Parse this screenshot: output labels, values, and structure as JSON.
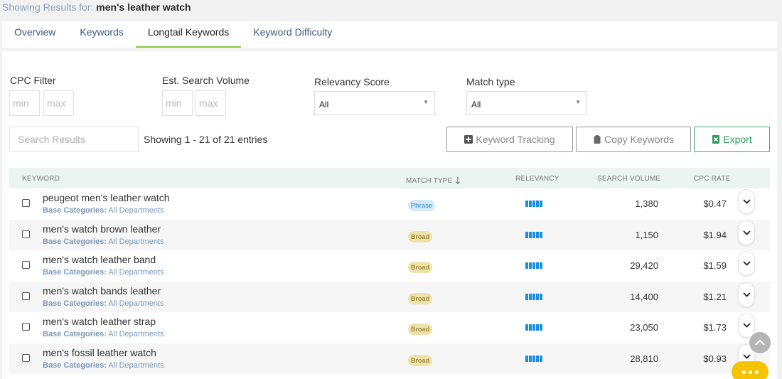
{
  "header": {
    "prefix": "Showing Results for:",
    "query": "men's leather watch"
  },
  "tabs": [
    {
      "label": "Overview"
    },
    {
      "label": "Keywords"
    },
    {
      "label": "Longtail Keywords",
      "active": true
    },
    {
      "label": "Keyword Difficulty"
    }
  ],
  "filters": {
    "cpc_label": "CPC Filter",
    "volume_label": "Est. Search Volume",
    "relevancy_label": "Relevancy Score",
    "match_label": "Match type",
    "min_placeholder": "min",
    "max_placeholder": "max",
    "relevancy_value": "All",
    "match_value": "All"
  },
  "search": {
    "placeholder": "Search Results"
  },
  "entries_text": "Showing 1 - 21 of 21 entries",
  "buttons": {
    "tracking": "Keyword Tracking",
    "copy": "Copy Keywords",
    "export": "Export"
  },
  "columns": {
    "keyword": "KEYWORD",
    "match": "MATCH TYPE",
    "relevancy": "RELEVANCY",
    "volume": "SEARCH VOLUME",
    "cpc": "CPC RATE"
  },
  "category_label": "Base Categories:",
  "rows": [
    {
      "keyword": "peugeot men's leather watch",
      "category": "All Departments",
      "match": "Phrase",
      "volume": "1,380",
      "cpc": "$0.47"
    },
    {
      "keyword": "men's watch brown leather",
      "category": "All Departments",
      "match": "Broad",
      "volume": "1,150",
      "cpc": "$1.94"
    },
    {
      "keyword": "men's watch leather band",
      "category": "All Departments",
      "match": "Broad",
      "volume": "29,420",
      "cpc": "$1.59"
    },
    {
      "keyword": "men's watch bands leather",
      "category": "All Departments",
      "match": "Broad",
      "volume": "14,400",
      "cpc": "$1.21"
    },
    {
      "keyword": "men's watch leather strap",
      "category": "All Departments",
      "match": "Broad",
      "volume": "23,050",
      "cpc": "$1.73"
    },
    {
      "keyword": "men's fossil leather watch",
      "category": "All Departments",
      "match": "Broad",
      "volume": "28,810",
      "cpc": "$0.93"
    }
  ],
  "icons": {
    "sort": "arrow-down-icon",
    "expand": "chevron-down-icon",
    "tracking": "plus-square-icon",
    "copy": "clipboard-icon",
    "export": "excel-icon",
    "scroll": "chevron-up-icon",
    "chat": "chat-dots-icon"
  },
  "colors": {
    "accent_green": "#8bc34a",
    "export_green": "#2e9b5a",
    "relevancy_blue": "#1a8fe0",
    "chat_yellow": "#f6c300"
  }
}
